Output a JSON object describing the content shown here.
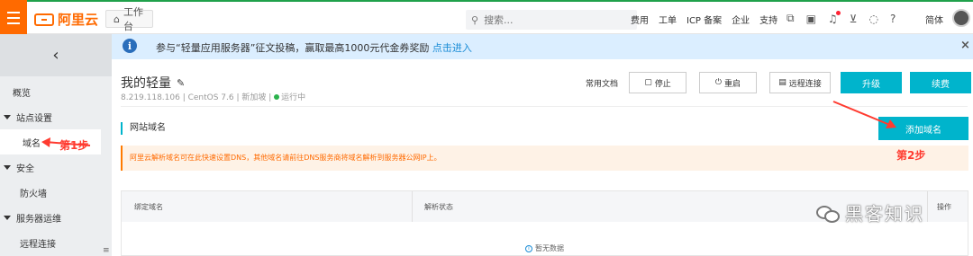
{
  "topbar": {
    "logo_text": "阿里云",
    "workbench": "工作台",
    "search_placeholder": "搜索...",
    "nav": [
      "费用",
      "工单",
      "ICP 备案",
      "企业",
      "支持"
    ],
    "icons": [
      "app-icon",
      "terminal-icon",
      "bell-icon",
      "cart-icon",
      "bulb-icon",
      "help-icon"
    ],
    "lang": "简体",
    "accent": "#ff6a00"
  },
  "sidebar": {
    "collapse_icon": "‹",
    "items": [
      {
        "label": "概览",
        "type": "item"
      },
      {
        "label": "站点设置",
        "type": "group"
      },
      {
        "label": "域名",
        "type": "sub",
        "active": true
      },
      {
        "label": "安全",
        "type": "group"
      },
      {
        "label": "防火墙",
        "type": "sub"
      },
      {
        "label": "服务器运维",
        "type": "group"
      },
      {
        "label": "远程连接",
        "type": "sub"
      }
    ]
  },
  "notice": {
    "text": "参与“轻量应用服务器”征文投稿，赢取最高1000元代金券奖励 ",
    "link": "点击进入",
    "close": "×"
  },
  "instance": {
    "name": "我的轻量",
    "meta": "8.219.118.106 | CentOS 7.6 | 新加坡 | ",
    "status": "运行中",
    "doc_link": "常用文档",
    "buttons": {
      "stop": "停止",
      "restart": "重启",
      "remote": "远程连接",
      "upgrade": "升级",
      "renew": "续费"
    }
  },
  "domain_section": {
    "title": "网站域名",
    "add_button": "添加域名",
    "warning": "阿里云解析域名可在此快速设置DNS，其他域名请前往DNS服务商将域名解析到服务器公网IP上。",
    "table": {
      "columns": [
        "绑定域名",
        "解析状态",
        "操作"
      ],
      "empty": "暂无数据"
    }
  },
  "annotations": {
    "step1": "第1步",
    "step2": "第2步",
    "color": "#ff3b30"
  },
  "watermark": "黑客知识"
}
